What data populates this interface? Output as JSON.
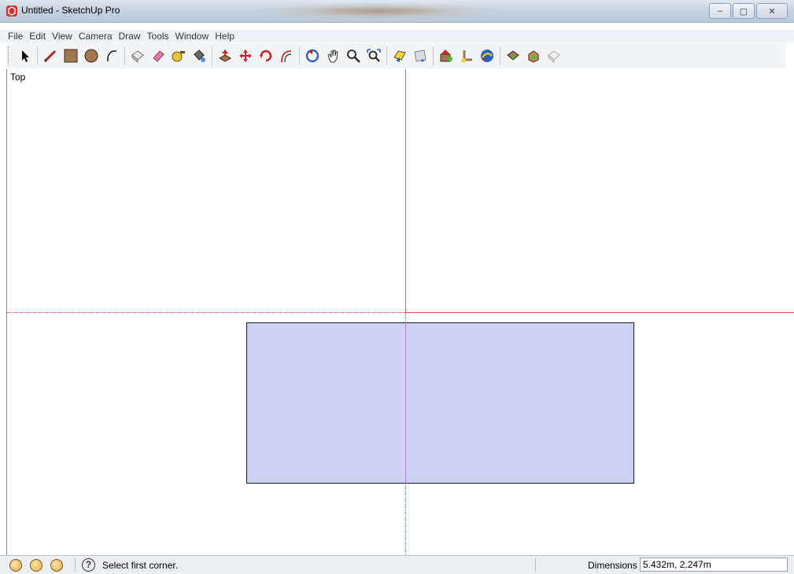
{
  "window": {
    "title": "Untitled - SketchUp Pro",
    "controls": {
      "minimize": "–",
      "maximize": "▢",
      "close": "✕"
    }
  },
  "menu": [
    "File",
    "Edit",
    "View",
    "Camera",
    "Draw",
    "Tools",
    "Window",
    "Help"
  ],
  "toolbar": {
    "tools": [
      "select-icon",
      "pencil-icon",
      "rectangle-icon",
      "circle-icon",
      "arc-icon",
      "make-component-icon",
      "eraser-icon",
      "tape-measure-icon",
      "paint-bucket-icon",
      "push-pull-icon",
      "move-icon",
      "rotate-icon",
      "offset-icon",
      "orbit-icon",
      "pan-icon",
      "zoom-icon",
      "zoom-extents-icon",
      "previous-view-icon",
      "next-view-icon",
      "add-location-icon",
      "toggle-terrain-icon",
      "get-models-icon",
      "share-model-icon",
      "share-component-icon",
      "extension-warehouse-icon"
    ]
  },
  "viewport": {
    "scene_label": "Top"
  },
  "status": {
    "message": "Select first corner.",
    "help_glyph": "?",
    "dimensions_label": "Dimensions",
    "dimensions_value": "5.432m, 2.247m"
  },
  "colors": {
    "face_fill": "#b8c0ec",
    "green_axis": "#3fbf3f",
    "red_axis": "#d9534f"
  }
}
